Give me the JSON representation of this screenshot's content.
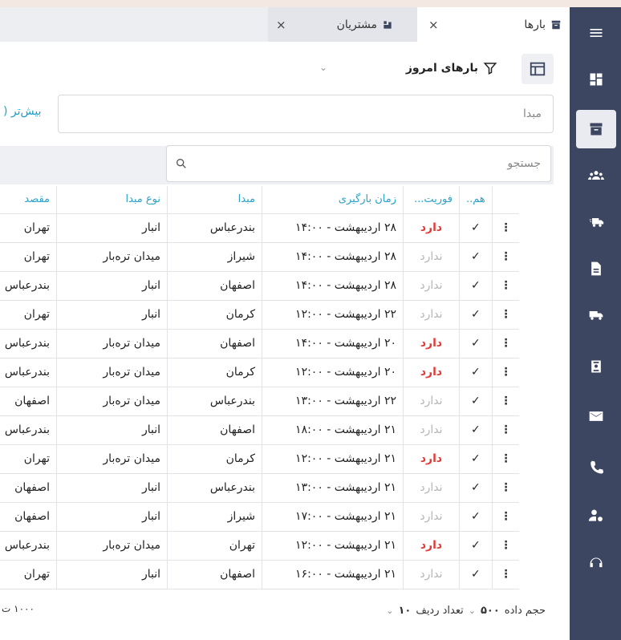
{
  "tabs": [
    {
      "label": "بارها",
      "close": "×"
    },
    {
      "label": "مشتریان",
      "close": "×"
    }
  ],
  "filter": {
    "title": "بارهای امروز"
  },
  "fields": {
    "origin_placeholder": "مبدا",
    "more_label": "بیش‌تر (",
    "search_placeholder": "جستجو"
  },
  "table": {
    "headers": [
      "هم..",
      "فوریت...",
      "زمان بارگیری",
      "مبدا",
      "نوع مبدا",
      "مقصد"
    ],
    "rows": [
      {
        "menu": "⋮",
        "check": "✓",
        "priority": "دارد",
        "urgent": true,
        "time": "۲۸ اردیبهشت - ۱۴:۰۰",
        "origin": "بندرعباس",
        "origin_type": "انبار",
        "dest": "تهران"
      },
      {
        "menu": "⋮",
        "check": "✓",
        "priority": "ندارد",
        "urgent": false,
        "time": "۲۸ اردیبهشت - ۱۴:۰۰",
        "origin": "شیراز",
        "origin_type": "میدان تره‌بار",
        "dest": "تهران"
      },
      {
        "menu": "⋮",
        "check": "✓",
        "priority": "ندارد",
        "urgent": false,
        "time": "۲۸ اردیبهشت - ۱۴:۰۰",
        "origin": "اصفهان",
        "origin_type": "انبار",
        "dest": "بندرعباس"
      },
      {
        "menu": "⋮",
        "check": "✓",
        "priority": "ندارد",
        "urgent": false,
        "time": "۲۲ اردیبهشت - ۱۲:۰۰",
        "origin": "کرمان",
        "origin_type": "انبار",
        "dest": "تهران"
      },
      {
        "menu": "⋮",
        "check": "✓",
        "priority": "دارد",
        "urgent": true,
        "time": "۲۰ اردیبهشت - ۱۴:۰۰",
        "origin": "اصفهان",
        "origin_type": "میدان تره‌بار",
        "dest": "بندرعباس"
      },
      {
        "menu": "⋮",
        "check": "✓",
        "priority": "دارد",
        "urgent": true,
        "time": "۲۰ اردیبهشت - ۱۲:۰۰",
        "origin": "کرمان",
        "origin_type": "میدان تره‌بار",
        "dest": "بندرعباس"
      },
      {
        "menu": "⋮",
        "check": "✓",
        "priority": "ندارد",
        "urgent": false,
        "time": "۲۲ اردیبهشت - ۱۳:۰۰",
        "origin": "بندرعباس",
        "origin_type": "میدان تره‌بار",
        "dest": "اصفهان"
      },
      {
        "menu": "⋮",
        "check": "✓",
        "priority": "ندارد",
        "urgent": false,
        "time": "۲۱ اردیبهشت - ۱۸:۰۰",
        "origin": "اصفهان",
        "origin_type": "انبار",
        "dest": "بندرعباس"
      },
      {
        "menu": "⋮",
        "check": "✓",
        "priority": "دارد",
        "urgent": true,
        "time": "۲۱ اردیبهشت - ۱۲:۰۰",
        "origin": "کرمان",
        "origin_type": "میدان تره‌بار",
        "dest": "تهران"
      },
      {
        "menu": "⋮",
        "check": "✓",
        "priority": "ندارد",
        "urgent": false,
        "time": "۲۱ اردیبهشت - ۱۳:۰۰",
        "origin": "بندرعباس",
        "origin_type": "انبار",
        "dest": "اصفهان"
      },
      {
        "menu": "⋮",
        "check": "✓",
        "priority": "ندارد",
        "urgent": false,
        "time": "۲۱ اردیبهشت - ۱۷:۰۰",
        "origin": "شیراز",
        "origin_type": "انبار",
        "dest": "اصفهان"
      },
      {
        "menu": "⋮",
        "check": "✓",
        "priority": "دارد",
        "urgent": true,
        "time": "۲۱ اردیبهشت - ۱۲:۰۰",
        "origin": "تهران",
        "origin_type": "میدان تره‌بار",
        "dest": "بندرعباس"
      },
      {
        "menu": "⋮",
        "check": "✓",
        "priority": "ندارد",
        "urgent": false,
        "time": "۲۱ اردیبهشت - ۱۶:۰۰",
        "origin": "اصفهان",
        "origin_type": "انبار",
        "dest": "تهران"
      }
    ]
  },
  "footer": {
    "data_size_label": "حجم داده",
    "data_size_value": "۵۰۰",
    "row_count_label": "تعداد ردیف",
    "row_count_value": "۱۰",
    "total": "۱۰۰۰ ت"
  },
  "sidebar_icons": [
    "menu-icon",
    "dashboard-icon",
    "archive-icon",
    "customers-icon",
    "truck-fast-icon",
    "document-icon",
    "truck-icon",
    "badge-icon",
    "mail-icon",
    "phone-icon",
    "user-settings-icon",
    "support-icon"
  ],
  "colors": {
    "sidebar": "#3d4660",
    "header_text": "#2aa2c9",
    "urgent": "#e53935",
    "muted": "#b5b5b5",
    "link": "#1da1c8"
  }
}
